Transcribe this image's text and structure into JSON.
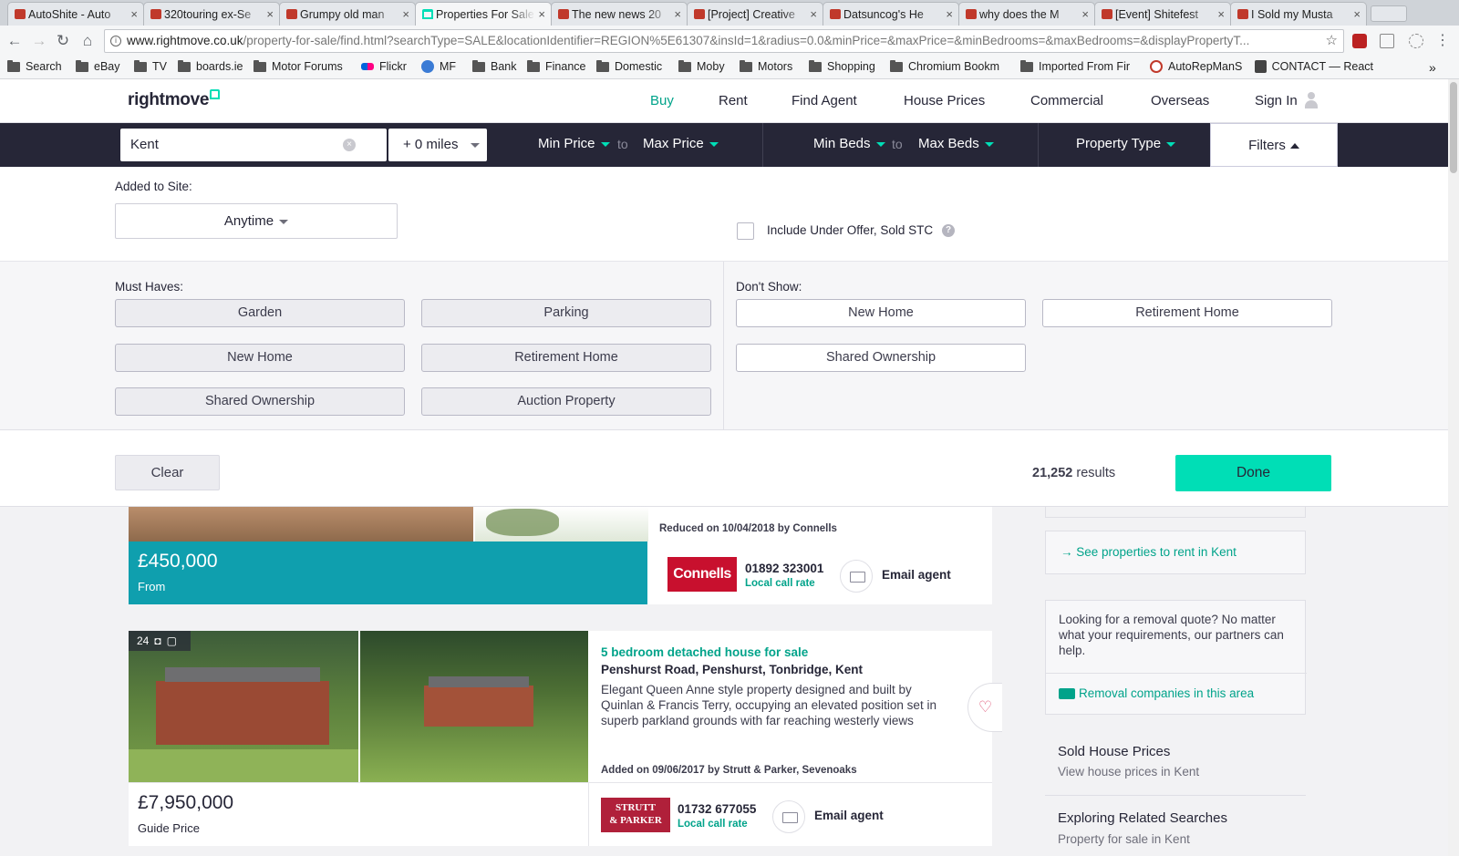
{
  "browser": {
    "tabs": [
      {
        "title": "AutoShite - Auto"
      },
      {
        "title": "320touring ex-Se"
      },
      {
        "title": "Grumpy old man"
      },
      {
        "title": "Properties For Sale"
      },
      {
        "title": "The new news 20"
      },
      {
        "title": "[Project] Creative"
      },
      {
        "title": "Datsuncog's He"
      },
      {
        "title": "why does the M"
      },
      {
        "title": "[Event] Shitefest"
      },
      {
        "title": "I Sold my Musta"
      }
    ],
    "tab_close": "×",
    "url_domain": "www.rightmove.co.uk",
    "url_rest": "/property-for-sale/find.html?searchType=SALE&locationIdentifier=REGION%5E61307&insId=1&radius=0.0&minPrice=&maxPrice=&minBedrooms=&maxBedrooms=&displayPropertyT...",
    "bookmarks": [
      "Search",
      "eBay",
      "TV",
      "boards.ie",
      "Motor Forums",
      "Flickr",
      "MF",
      "Bank",
      "Finance",
      "Domestic",
      "Moby",
      "Motors",
      "Shopping",
      "Chromium Bookm",
      "Imported From Fir",
      "AutoRepManS",
      "CONTACT — React"
    ],
    "bookmarks_more": "»"
  },
  "site": {
    "logo": "rightmove",
    "nav": [
      "Buy",
      "Rent",
      "Find Agent",
      "House Prices",
      "Commercial",
      "Overseas",
      "Sign In"
    ]
  },
  "search": {
    "location": "Kent",
    "clear_glyph": "×",
    "radius": "+ 0 miles",
    "min_price": "Min Price",
    "max_price": "Max Price",
    "to": "to",
    "min_beds": "Min Beds",
    "max_beds": "Max Beds",
    "property_type": "Property Type",
    "filters": "Filters"
  },
  "filters": {
    "added_label": "Added to Site:",
    "added_value": "Anytime",
    "include_offer": "Include Under Offer, Sold STC",
    "help_glyph": "?",
    "must_haves_label": "Must Haves:",
    "must_haves": [
      "Garden",
      "Parking",
      "New Home",
      "Retirement Home",
      "Shared Ownership",
      "Auction Property"
    ],
    "dont_show_label": "Don't Show:",
    "dont_show": [
      "New Home",
      "Retirement Home",
      "Shared Ownership"
    ],
    "clear": "Clear",
    "results_count": "21,252",
    "results_word": "results",
    "done": "Done"
  },
  "listings": [
    {
      "added": "Reduced on 10/04/2018 by Connells",
      "price": "£450,000",
      "price_qualifier": "From",
      "agent": "Connells",
      "phone": "01892 323001",
      "call_rate": "Local call rate",
      "email": "Email agent"
    },
    {
      "photo_count": "24",
      "title": "5 bedroom detached house for sale",
      "address": "Penshurst Road, Penshurst, Tonbridge, Kent",
      "description": "Elegant Queen Anne style property designed and built by Quinlan & Francis Terry, occupying an elevated position set in superb parkland grounds with far reaching westerly views",
      "added": "Added on 09/06/2017 by Strutt & Parker, Sevenoaks",
      "price": "£7,950,000",
      "price_qualifier": "Guide Price",
      "agent_line1": "STRUTT",
      "agent_line2": "& PARKER",
      "phone": "01732 677055",
      "call_rate": "Local call rate",
      "email": "Email agent"
    }
  ],
  "sidebar": {
    "rent_link": "See properties to rent in Kent",
    "removal_text": "Looking for a removal quote? No matter what your requirements, our partners can help.",
    "removal_link": "Removal companies in this area",
    "sold_head": "Sold House Prices",
    "sold_sub": "View house prices in Kent",
    "related_head": "Exploring Related Searches",
    "related_sub": "Property for sale in Kent"
  },
  "colors": {
    "brand_teal": "#00deb6",
    "link_teal": "#00a38a",
    "navy": "#262637",
    "price_band": "#0f9fae",
    "connells_red": "#c8102e",
    "strutt_red": "#b0203a"
  }
}
